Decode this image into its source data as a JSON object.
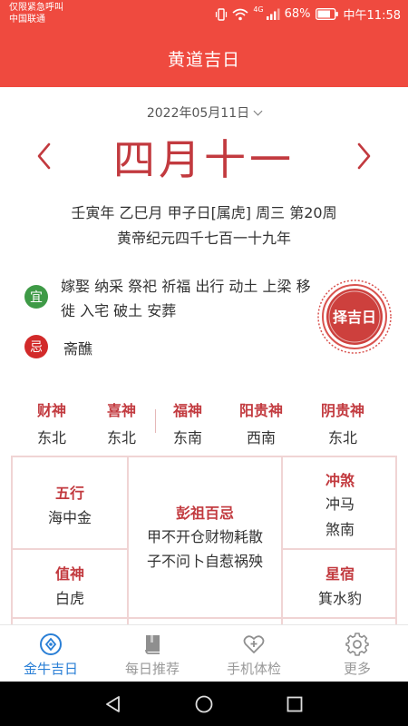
{
  "status_bar": {
    "carrier_line1": "仅限紧急呼叫",
    "carrier_line2": "中国联通",
    "battery": "68%",
    "time": "中午11:58",
    "signal_label": "4G"
  },
  "header": {
    "title": "黄道吉日"
  },
  "date": {
    "selected": "2022年05月11日",
    "lunar_day": "四月十一",
    "ganzhi": "壬寅年 乙巳月 甲子日[属虎] 周三 第20周",
    "huangdi": "黄帝纪元四千七百一十九年",
    "prev_icon": "chevron-left-icon",
    "next_icon": "chevron-right-icon"
  },
  "yi": {
    "label": "宜",
    "text": "嫁娶 纳采 祭祀 祈福 出行 动土 上梁 移徙 入宅 破土 安葬"
  },
  "ji": {
    "label": "忌",
    "text": "斋醮"
  },
  "stamp": {
    "text": "择吉日"
  },
  "gods": [
    {
      "name": "财神",
      "dir": "东北"
    },
    {
      "name": "喜神",
      "dir": "东北"
    },
    {
      "name": "福神",
      "dir": "东南"
    },
    {
      "name": "阳贵神",
      "dir": "西南"
    },
    {
      "name": "阴贵神",
      "dir": "东北"
    }
  ],
  "almanac": {
    "wuxing": {
      "title": "五行",
      "value": "海中金"
    },
    "zhishen": {
      "title": "值神",
      "value": "白虎"
    },
    "pengzu": {
      "title": "彭祖百忌",
      "line1": "甲不开仓财物耗散",
      "line2": "子不问卜自惹祸殃"
    },
    "chongsha": {
      "title": "冲煞",
      "line1": "冲马",
      "line2": "煞南"
    },
    "xingsu": {
      "title": "星宿",
      "value": "箕水豹"
    }
  },
  "nav": [
    {
      "label": "金牛吉日",
      "icon": "compass-icon",
      "active": true
    },
    {
      "label": "每日推荐",
      "icon": "book-icon",
      "active": false
    },
    {
      "label": "手机体检",
      "icon": "heart-plus-icon",
      "active": false
    },
    {
      "label": "更多",
      "icon": "gear-icon",
      "active": false
    }
  ],
  "colors": {
    "primary_red": "#ef4a3f",
    "deep_red": "#c23a3f",
    "yi_green": "#3e9a46",
    "ji_red": "#d22a2a",
    "nav_active_blue": "#2a7fd6"
  }
}
